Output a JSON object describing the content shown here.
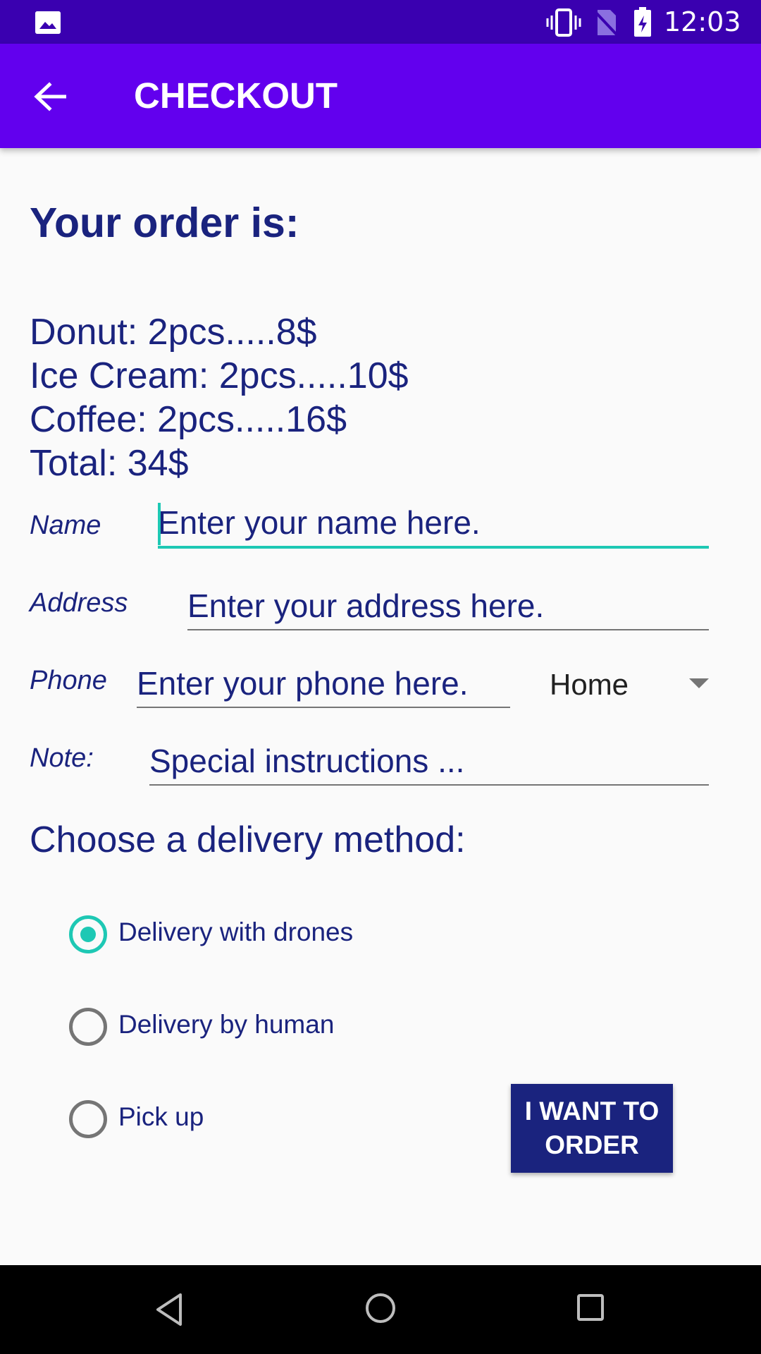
{
  "status_bar": {
    "time": "12:03",
    "icons": [
      "gallery-icon",
      "vibrate-icon",
      "no-sim-icon",
      "battery-charging-icon"
    ]
  },
  "app_bar": {
    "title": "CHECKOUT",
    "back_icon": "arrow-back-icon"
  },
  "order": {
    "heading": "Your order is:",
    "lines": [
      "Donut: 2pcs.....8$",
      "Ice Cream: 2pcs.....10$",
      "Coffee: 2pcs.....16$",
      "Total: 34$"
    ]
  },
  "form": {
    "name": {
      "label": "Name",
      "placeholder": "Enter your name here.",
      "value": ""
    },
    "address": {
      "label": "Address",
      "placeholder": "Enter your address here.",
      "value": ""
    },
    "phone": {
      "label": "Phone",
      "placeholder": "Enter your phone here.",
      "value": "",
      "type_selected": "Home"
    },
    "note": {
      "label": "Note:",
      "placeholder": "Special instructions ...",
      "value": ""
    }
  },
  "delivery": {
    "heading": "Choose a delivery method:",
    "options": [
      {
        "label": "Delivery with drones",
        "checked": true
      },
      {
        "label": "Delivery by human",
        "checked": false
      },
      {
        "label": "Pick up",
        "checked": false
      }
    ]
  },
  "order_button": {
    "label": "I WANT TO ORDER"
  },
  "nav_bar": {
    "icons": [
      "nav-back-icon",
      "nav-home-icon",
      "nav-recents-icon"
    ]
  },
  "colors": {
    "status_bar": "#3a00b0",
    "app_bar": "#6200ee",
    "accent": "#1ec8b4",
    "text_primary": "#1a237e",
    "button": "#1a237e"
  }
}
